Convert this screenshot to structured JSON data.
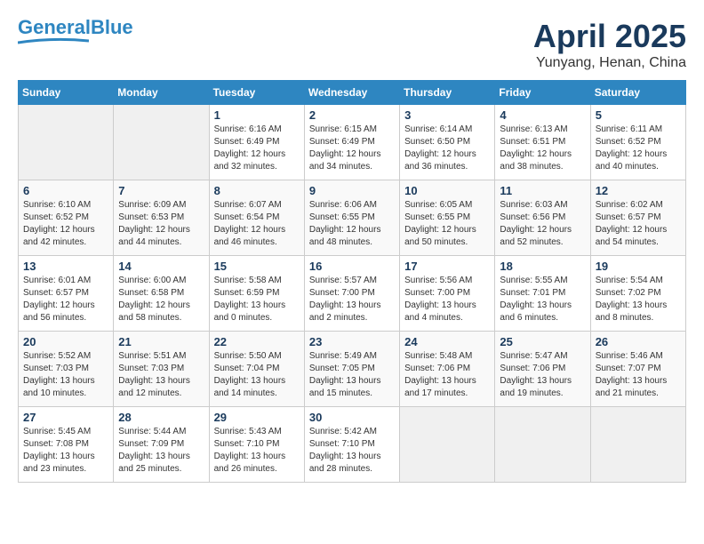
{
  "header": {
    "logo_line1": "General",
    "logo_line2": "Blue",
    "title": "April 2025",
    "subtitle": "Yunyang, Henan, China"
  },
  "weekdays": [
    "Sunday",
    "Monday",
    "Tuesday",
    "Wednesday",
    "Thursday",
    "Friday",
    "Saturday"
  ],
  "weeks": [
    [
      {
        "day": "",
        "info": ""
      },
      {
        "day": "",
        "info": ""
      },
      {
        "day": "1",
        "info": "Sunrise: 6:16 AM\nSunset: 6:49 PM\nDaylight: 12 hours\nand 32 minutes."
      },
      {
        "day": "2",
        "info": "Sunrise: 6:15 AM\nSunset: 6:49 PM\nDaylight: 12 hours\nand 34 minutes."
      },
      {
        "day": "3",
        "info": "Sunrise: 6:14 AM\nSunset: 6:50 PM\nDaylight: 12 hours\nand 36 minutes."
      },
      {
        "day": "4",
        "info": "Sunrise: 6:13 AM\nSunset: 6:51 PM\nDaylight: 12 hours\nand 38 minutes."
      },
      {
        "day": "5",
        "info": "Sunrise: 6:11 AM\nSunset: 6:52 PM\nDaylight: 12 hours\nand 40 minutes."
      }
    ],
    [
      {
        "day": "6",
        "info": "Sunrise: 6:10 AM\nSunset: 6:52 PM\nDaylight: 12 hours\nand 42 minutes."
      },
      {
        "day": "7",
        "info": "Sunrise: 6:09 AM\nSunset: 6:53 PM\nDaylight: 12 hours\nand 44 minutes."
      },
      {
        "day": "8",
        "info": "Sunrise: 6:07 AM\nSunset: 6:54 PM\nDaylight: 12 hours\nand 46 minutes."
      },
      {
        "day": "9",
        "info": "Sunrise: 6:06 AM\nSunset: 6:55 PM\nDaylight: 12 hours\nand 48 minutes."
      },
      {
        "day": "10",
        "info": "Sunrise: 6:05 AM\nSunset: 6:55 PM\nDaylight: 12 hours\nand 50 minutes."
      },
      {
        "day": "11",
        "info": "Sunrise: 6:03 AM\nSunset: 6:56 PM\nDaylight: 12 hours\nand 52 minutes."
      },
      {
        "day": "12",
        "info": "Sunrise: 6:02 AM\nSunset: 6:57 PM\nDaylight: 12 hours\nand 54 minutes."
      }
    ],
    [
      {
        "day": "13",
        "info": "Sunrise: 6:01 AM\nSunset: 6:57 PM\nDaylight: 12 hours\nand 56 minutes."
      },
      {
        "day": "14",
        "info": "Sunrise: 6:00 AM\nSunset: 6:58 PM\nDaylight: 12 hours\nand 58 minutes."
      },
      {
        "day": "15",
        "info": "Sunrise: 5:58 AM\nSunset: 6:59 PM\nDaylight: 13 hours\nand 0 minutes."
      },
      {
        "day": "16",
        "info": "Sunrise: 5:57 AM\nSunset: 7:00 PM\nDaylight: 13 hours\nand 2 minutes."
      },
      {
        "day": "17",
        "info": "Sunrise: 5:56 AM\nSunset: 7:00 PM\nDaylight: 13 hours\nand 4 minutes."
      },
      {
        "day": "18",
        "info": "Sunrise: 5:55 AM\nSunset: 7:01 PM\nDaylight: 13 hours\nand 6 minutes."
      },
      {
        "day": "19",
        "info": "Sunrise: 5:54 AM\nSunset: 7:02 PM\nDaylight: 13 hours\nand 8 minutes."
      }
    ],
    [
      {
        "day": "20",
        "info": "Sunrise: 5:52 AM\nSunset: 7:03 PM\nDaylight: 13 hours\nand 10 minutes."
      },
      {
        "day": "21",
        "info": "Sunrise: 5:51 AM\nSunset: 7:03 PM\nDaylight: 13 hours\nand 12 minutes."
      },
      {
        "day": "22",
        "info": "Sunrise: 5:50 AM\nSunset: 7:04 PM\nDaylight: 13 hours\nand 14 minutes."
      },
      {
        "day": "23",
        "info": "Sunrise: 5:49 AM\nSunset: 7:05 PM\nDaylight: 13 hours\nand 15 minutes."
      },
      {
        "day": "24",
        "info": "Sunrise: 5:48 AM\nSunset: 7:06 PM\nDaylight: 13 hours\nand 17 minutes."
      },
      {
        "day": "25",
        "info": "Sunrise: 5:47 AM\nSunset: 7:06 PM\nDaylight: 13 hours\nand 19 minutes."
      },
      {
        "day": "26",
        "info": "Sunrise: 5:46 AM\nSunset: 7:07 PM\nDaylight: 13 hours\nand 21 minutes."
      }
    ],
    [
      {
        "day": "27",
        "info": "Sunrise: 5:45 AM\nSunset: 7:08 PM\nDaylight: 13 hours\nand 23 minutes."
      },
      {
        "day": "28",
        "info": "Sunrise: 5:44 AM\nSunset: 7:09 PM\nDaylight: 13 hours\nand 25 minutes."
      },
      {
        "day": "29",
        "info": "Sunrise: 5:43 AM\nSunset: 7:10 PM\nDaylight: 13 hours\nand 26 minutes."
      },
      {
        "day": "30",
        "info": "Sunrise: 5:42 AM\nSunset: 7:10 PM\nDaylight: 13 hours\nand 28 minutes."
      },
      {
        "day": "",
        "info": ""
      },
      {
        "day": "",
        "info": ""
      },
      {
        "day": "",
        "info": ""
      }
    ]
  ]
}
